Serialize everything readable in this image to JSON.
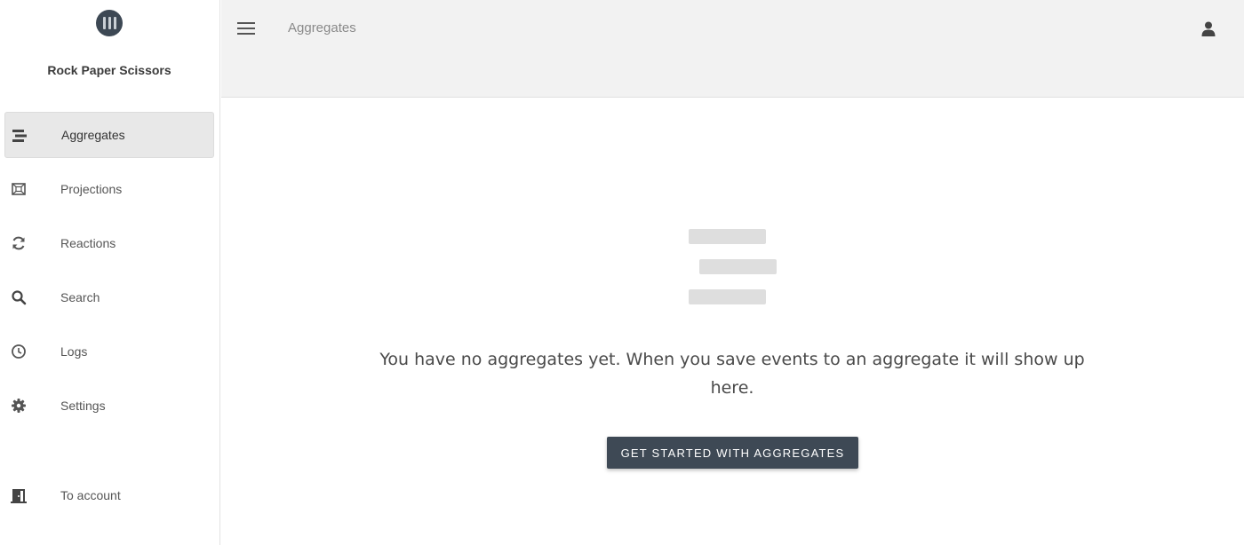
{
  "app": {
    "name": "Rock Paper Scissors"
  },
  "sidebar": {
    "items": [
      {
        "label": "Aggregates",
        "icon": "aggregates-icon",
        "active": true
      },
      {
        "label": "Projections",
        "icon": "projections-icon",
        "active": false
      },
      {
        "label": "Reactions",
        "icon": "refresh-icon",
        "active": false
      },
      {
        "label": "Search",
        "icon": "search-icon",
        "active": false
      },
      {
        "label": "Logs",
        "icon": "clock-icon",
        "active": false
      },
      {
        "label": "Settings",
        "icon": "gear-icon",
        "active": false
      }
    ],
    "account": {
      "label": "To account",
      "icon": "door-icon"
    }
  },
  "header": {
    "title": "Aggregates"
  },
  "main": {
    "empty_message": "You have no aggregates yet. When you save events to an aggregate it will show up here.",
    "cta_label": "GET STARTED WITH AGGREGATES"
  },
  "colors": {
    "accent": "#3e4955",
    "sidebar_active": "#e8e8e8",
    "topbar_bg": "#f2f2f2",
    "placeholder": "#dedede"
  }
}
